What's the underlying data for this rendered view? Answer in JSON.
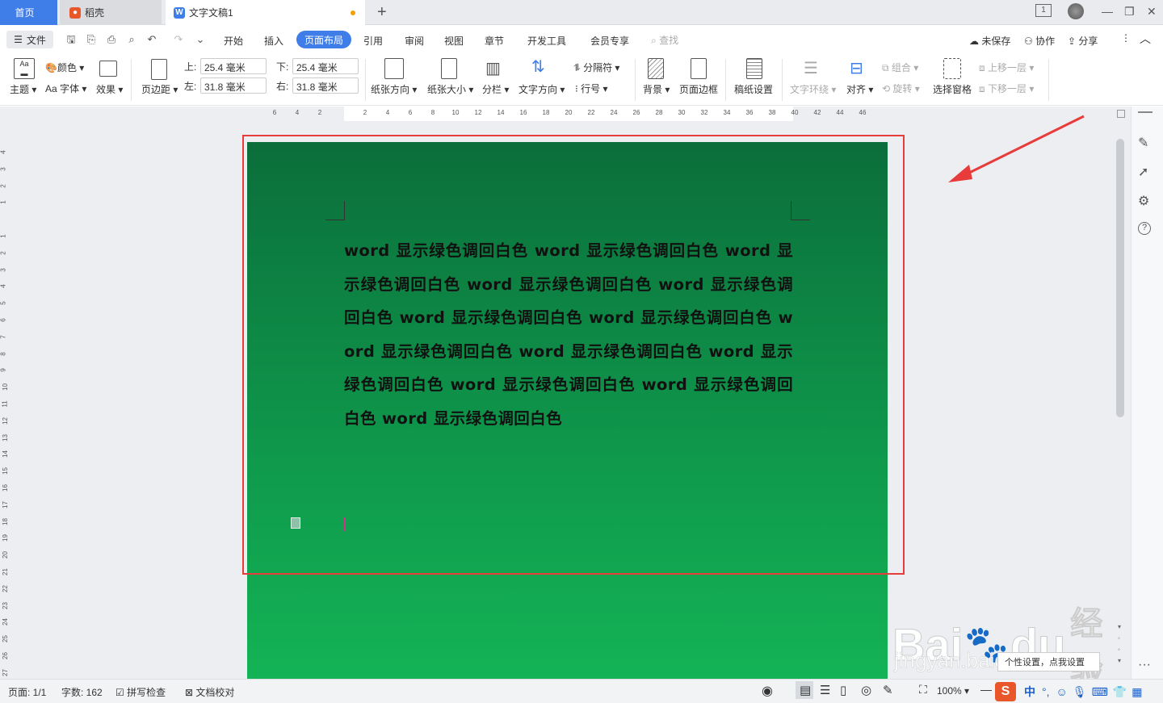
{
  "tabs": {
    "home": "首页",
    "daoke": "稻壳",
    "doc": "文字文稿1",
    "page_indicator": "1"
  },
  "menubar": {
    "file": "文件",
    "items": [
      "开始",
      "插入",
      "页面布局",
      "引用",
      "审阅",
      "视图",
      "章节",
      "开发工具",
      "会员专享"
    ],
    "active": "页面布局",
    "search": "查找",
    "unsaved": "未保存",
    "collab": "协作",
    "share": "分享"
  },
  "ribbon": {
    "theme": "主题",
    "color": "颜色",
    "font": "字体",
    "effect": "效果",
    "margins": "页边距",
    "top_label": "上:",
    "top_value": "25.4 毫米",
    "bottom_label": "下:",
    "bottom_value": "25.4 毫米",
    "left_label": "左:",
    "left_value": "31.8 毫米",
    "right_label": "右:",
    "right_value": "31.8 毫米",
    "orientation": "纸张方向",
    "size": "纸张大小",
    "columns": "分栏",
    "text_dir": "文字方向",
    "break": "分隔符",
    "line_no": "行号",
    "background": "背景",
    "page_border": "页面边框",
    "grid_paper": "稿纸设置",
    "wrap": "文字环绕",
    "align": "对齐",
    "group": "组合",
    "rotate": "旋转",
    "select_pane": "选择窗格",
    "bring_forward": "上移一层",
    "send_backward": "下移一层"
  },
  "ruler": {
    "h": [
      "6",
      "4",
      "2",
      "",
      "2",
      "4",
      "6",
      "8",
      "10",
      "12",
      "14",
      "16",
      "18",
      "20",
      "22",
      "24",
      "26",
      "28",
      "30",
      "32",
      "34",
      "36",
      "38",
      "40",
      "42",
      "44",
      "46"
    ],
    "v": [
      "4",
      "3",
      "2",
      "1",
      "",
      "1",
      "2",
      "3",
      "4",
      "5",
      "6",
      "7",
      "8",
      "9",
      "10",
      "11",
      "12",
      "13",
      "14",
      "15",
      "16",
      "17",
      "18",
      "19",
      "20",
      "21",
      "22",
      "23",
      "24",
      "25",
      "26",
      "27"
    ]
  },
  "document": {
    "text": "word 显示绿色调回白色 word 显示绿色调回白色 word 显示绿色调回白色 word 显示绿色调回白色 word 显示绿色调回白色 word 显示绿色调回白色 word 显示绿色调回白色 word 显示绿色调回白色 word 显示绿色调回白色 word 显示绿色调回白色 word 显示绿色调回白色 word 显示绿色调回白色 word 显示绿色调回白色"
  },
  "status": {
    "page": "页面: 1/1",
    "words": "字数: 162",
    "spell": "拼写检查",
    "proof": "文档校对",
    "zoom": "100%"
  },
  "watermark": {
    "brand": "Bai",
    "brand2": "du",
    "cn": "经验",
    "url": "jingyan.baidu.com"
  },
  "tooltip": "个性设置，点我设置",
  "ime": {
    "lang": "中"
  },
  "colors": {
    "accent": "#3f7ee8",
    "page_green": "#0f9a4c",
    "annotation_red": "#e83b3b"
  }
}
